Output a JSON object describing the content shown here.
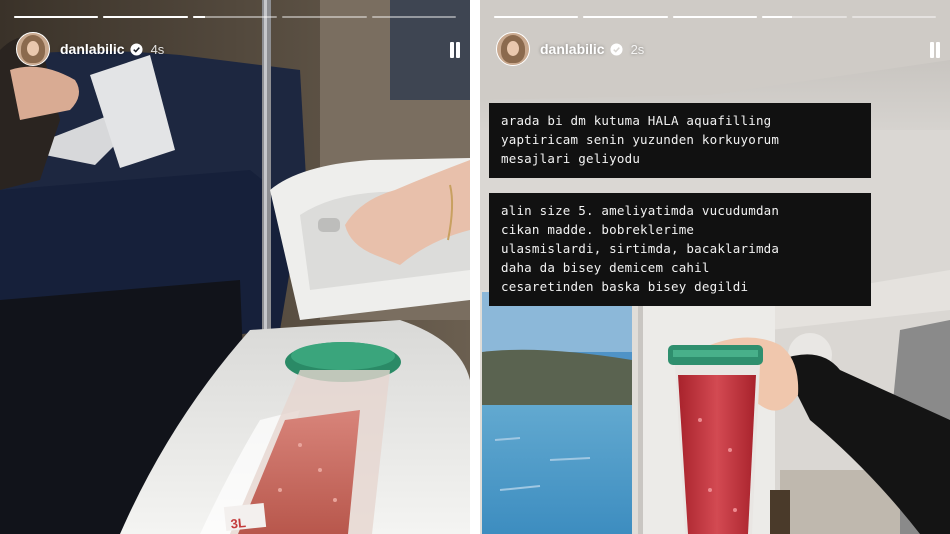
{
  "stories": [
    {
      "username": "danlabilic",
      "time_ago": "4s",
      "progress_segments": [
        1,
        1,
        0.15,
        0,
        0
      ],
      "bag_label": "3L"
    },
    {
      "username": "danlabilic",
      "time_ago": "2s",
      "progress_segments": [
        1,
        1,
        1,
        0.35,
        0
      ],
      "captions": [
        {
          "lines": [
            "arada bi dm kutuma HALA aquafilling",
            "yaptiricam senin yuzunden korkuyorum",
            "mesajlari geliyodu"
          ]
        },
        {
          "lines": [
            "alin size 5. ameliyatimda vucudumdan",
            "cikan madde. bobreklerime",
            "ulasmislardi, sirtimda, bacaklarimda",
            "daha da bisey demicem cahil",
            "cesaretinden baska bisey degildi"
          ]
        }
      ]
    }
  ],
  "colors": {
    "verified_badge": "#ffffff",
    "caption_bg": "#111111",
    "bag_cap_green": "#2f8f6e",
    "bag_fluid_red": "#c0323a"
  }
}
